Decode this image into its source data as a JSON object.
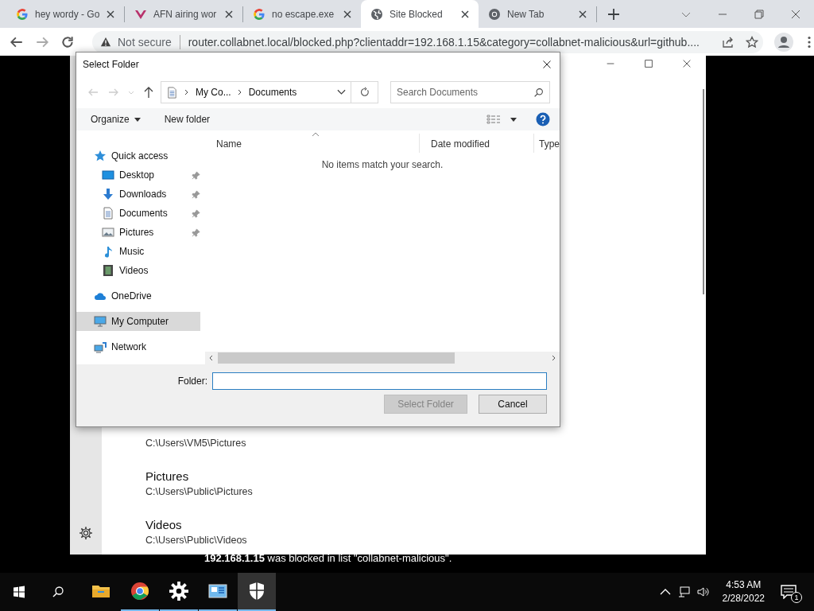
{
  "browser": {
    "tabs": [
      {
        "title": "hey wordy - Go",
        "kind": "google",
        "selected": false
      },
      {
        "title": "AFN airing wor",
        "kind": "mail",
        "selected": false
      },
      {
        "title": "no escape.exe",
        "kind": "google",
        "selected": false
      },
      {
        "title": "Site Blocked",
        "kind": "globe",
        "selected": true
      },
      {
        "title": "New Tab",
        "kind": "chrome",
        "selected": false
      }
    ],
    "address": {
      "security": "Not secure",
      "url": "router.collabnet.local/blocked.php?clientaddr=192.168.1.15&category=collabnet-malicious&url=github...."
    }
  },
  "page": {
    "blocked_message": "**192.168.1.15** was blocked in list \"collabnet-malicious\"."
  },
  "settings_window": {
    "folders": [
      {
        "path": "C:\\Users\\VM5\\Pictures"
      },
      {
        "name": "Pictures",
        "path": "C:\\Users\\Public\\Pictures"
      },
      {
        "name": "Videos",
        "path": "C:\\Users\\Public\\Videos"
      }
    ]
  },
  "dialog": {
    "title": "Select Folder",
    "breadcrumb": [
      "My Co...",
      "Documents"
    ],
    "search": {
      "placeholder": "Search Documents"
    },
    "toolbar": [
      "Organize",
      "New folder"
    ],
    "columns": [
      "Name",
      "Date modified",
      "Type"
    ],
    "empty_message": "No items match your search.",
    "nav": [
      {
        "label": "Quick access",
        "kind": "star",
        "selected": false,
        "children": [
          {
            "label": "Desktop",
            "kind": "desktop",
            "pinned": true,
            "selected": false
          },
          {
            "label": "Downloads",
            "kind": "download",
            "pinned": true,
            "selected": false
          },
          {
            "label": "Documents",
            "kind": "document",
            "pinned": true,
            "selected": false
          },
          {
            "label": "Pictures",
            "kind": "pictures",
            "pinned": true,
            "selected": false
          },
          {
            "label": "Music",
            "kind": "music",
            "pinned": false,
            "selected": false
          },
          {
            "label": "Videos",
            "kind": "video",
            "pinned": false,
            "selected": false
          }
        ]
      },
      {
        "label": "OneDrive",
        "kind": "cloud",
        "selected": false
      },
      {
        "label": "My Computer",
        "kind": "computer",
        "selected": true
      },
      {
        "label": "Network",
        "kind": "network",
        "selected": false
      }
    ],
    "folder_label": "Folder:",
    "buttons": [
      {
        "label": "Select Folder",
        "disabled": true
      },
      {
        "label": "Cancel",
        "disabled": false
      }
    ]
  },
  "taskbar": {
    "apps": [
      {
        "kind": "explorer",
        "running": false,
        "selected": false
      },
      {
        "kind": "chrome",
        "running": true,
        "selected": false
      },
      {
        "kind": "settings",
        "running": true,
        "selected": false
      },
      {
        "kind": "control-panel",
        "running": true,
        "selected": false
      },
      {
        "kind": "security",
        "running": true,
        "selected": true
      }
    ],
    "time": "4:53 AM",
    "date": "2/28/2022",
    "notifications": "1"
  }
}
